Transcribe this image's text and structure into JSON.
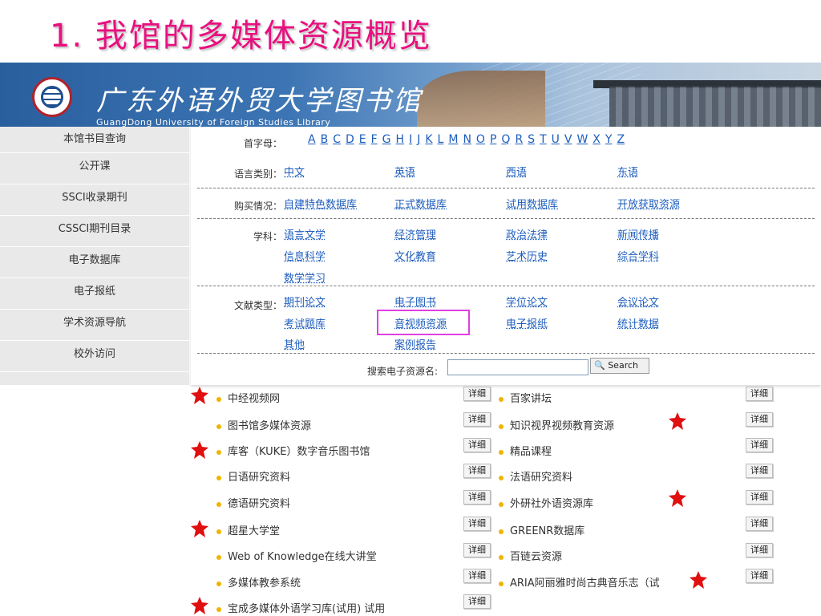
{
  "slide_title": "1. 我馆的多媒体资源概览",
  "banner": {
    "library_name": "广东外语外贸大学图书馆",
    "library_name_en": "GuangDong University of Foreign Studies Library"
  },
  "sidebar": {
    "items": [
      "本馆书目查询",
      "公开课",
      "SSCI收录期刊",
      "CSSCI期刊目录",
      "电子数据库",
      "电子报纸",
      "学术资源导航",
      "校外访问"
    ]
  },
  "filters": {
    "initial_label": "首字母：",
    "letters": [
      "A",
      "B",
      "C",
      "D",
      "E",
      "F",
      "G",
      "H",
      "I",
      "J",
      "K",
      "L",
      "M",
      "N",
      "O",
      "P",
      "Q",
      "R",
      "S",
      "T",
      "U",
      "V",
      "W",
      "X",
      "Y",
      "Z"
    ],
    "language_label": "语言类别：",
    "languages": [
      "中文",
      "英语",
      "西语",
      "东语"
    ],
    "purchase_label": "购买情况：",
    "purchase": [
      "自建特色数据库",
      "正式数据库",
      "试用数据库",
      "开放获取资源"
    ],
    "subject_label": "学科：",
    "subjects": [
      "语言文学",
      "经济管理",
      "政治法律",
      "新闻传播",
      "信息科学",
      "文化教育",
      "艺术历史",
      "综合学科",
      "数学学习"
    ],
    "doctype_label": "文献类型：",
    "doctypes": [
      "期刊论文",
      "电子图书",
      "学位论文",
      "会议论文",
      "考试题库",
      "音视频资源",
      "电子报纸",
      "统计数据",
      "其他",
      "案例报告"
    ],
    "search_label": "搜索电子资源名:",
    "search_value": "",
    "search_button": "Search"
  },
  "resources": {
    "detail_label": "详细",
    "left": [
      "中经视频网",
      "图书馆多媒体资源",
      "库客（KUKE）数字音乐图书馆",
      "日语研究资料",
      "德语研究资料",
      "超星大学堂",
      "Web of Knowledge在线大讲堂",
      "多媒体教参系统",
      "宝成多媒体外语学习库(试用)  试用"
    ],
    "right": [
      "百家讲坛",
      "知识视界视频教育资源",
      "精品课程",
      "法语研究资料",
      "外研社外语资源库",
      "GREENR数据库",
      "百链云资源",
      "ARIA阿丽雅时尚古典音乐志（试"
    ]
  },
  "colors": {
    "title": "#e8107f",
    "link": "#1d5dbd",
    "star": "#e01010",
    "highlight": "#e040e0"
  }
}
